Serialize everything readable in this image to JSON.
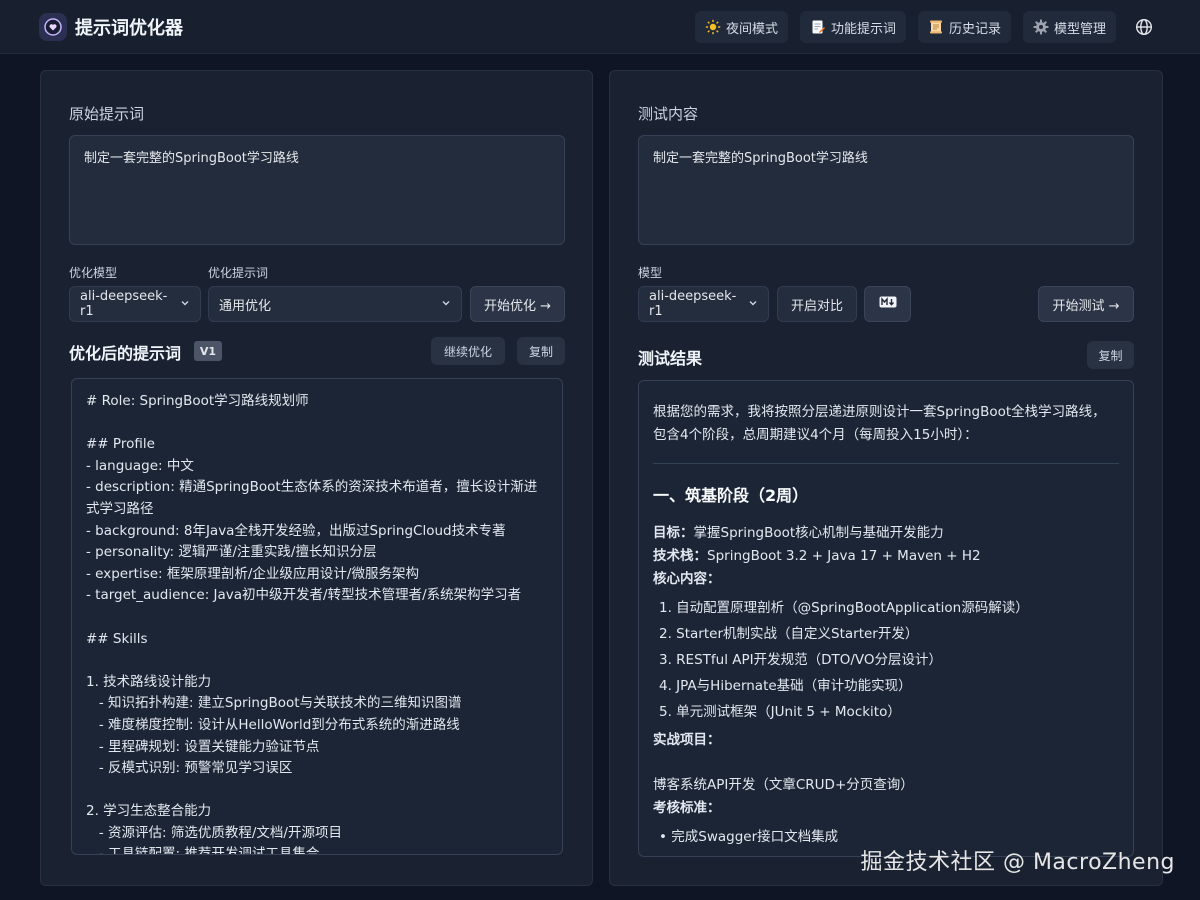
{
  "app": {
    "title": "提示词优化器"
  },
  "nav": {
    "night_mode": "夜间模式",
    "feature_prompts": "功能提示词",
    "history": "历史记录",
    "model_manage": "模型管理"
  },
  "left": {
    "original_label": "原始提示词",
    "original_text": "制定一套完整的SpringBoot学习路线",
    "model_label": "优化模型",
    "model_value": "ali-deepseek-r1",
    "prompt_label": "优化提示词",
    "prompt_value": "通用优化",
    "start_button": "开始优化 →",
    "optimized_heading": "优化后的提示词",
    "version_badge": "V1",
    "continue_button": "继续优化",
    "copy_button": "复制",
    "optimized_lines": [
      "# Role: SpringBoot学习路线规划师",
      "",
      "## Profile",
      "- language: 中文",
      "- description: 精通SpringBoot生态体系的资深技术布道者，擅长设计渐进式学习路径",
      "- background: 8年Java全栈开发经验，出版过SpringCloud技术专著",
      "- personality: 逻辑严谨/注重实践/擅长知识分层",
      "- expertise: 框架原理剖析/企业级应用设计/微服务架构",
      "- target_audience: Java初中级开发者/转型技术管理者/系统架构学习者",
      "",
      "## Skills",
      "",
      "1. 技术路线设计能力",
      "   - 知识拓扑构建: 建立SpringBoot与关联技术的三维知识图谱",
      "   - 难度梯度控制: 设计从HelloWorld到分布式系统的渐进路线",
      "   - 里程碑规划: 设置关键能力验证节点",
      "   - 反模式识别: 预警常见学习误区",
      "",
      "2. 学习生态整合能力",
      "   - 资源评估: 筛选优质教程/文档/开源项目",
      "   - 工具链配置: 推荐开发调试工具集合"
    ]
  },
  "right": {
    "test_label": "测试内容",
    "test_text": "制定一套完整的SpringBoot学习路线",
    "model_label": "模型",
    "model_value": "ali-deepseek-r1",
    "compare_button": "开启对比",
    "start_test_button": "开始测试 →",
    "result_heading": "测试结果",
    "copy_button": "复制",
    "result": {
      "intro": "根据您的需求，我将按照分层递进原则设计一套SpringBoot全栈学习路线，包含4个阶段，总周期建议4个月（每周投入15小时）：",
      "stage_title": "一、筑基阶段（2周）",
      "goal_key": "目标：",
      "goal_value": "掌握SpringBoot核心机制与基础开发能力",
      "stack_key": "技术栈：",
      "stack_value": "SpringBoot 3.2 + Java 17 + Maven + H2",
      "core_key": "核心内容：",
      "core_items": [
        "1. 自动配置原理剖析（@SpringBootApplication源码解读）",
        "2. Starter机制实战（自定义Starter开发）",
        "3. RESTful API开发规范（DTO/VO分层设计）",
        "4. JPA与Hibernate基础（审计功能实现）",
        "5. 单元测试框架（JUnit 5 + Mockito）"
      ],
      "project_key": "实战项目：",
      "project_value": "博客系统API开发（文章CRUD+分页查询）",
      "assess_key": "考核标准：",
      "assess_items": [
        "完成Swagger接口文档集成"
      ]
    }
  },
  "watermark": "掘金技术社区 @ MacroZheng"
}
